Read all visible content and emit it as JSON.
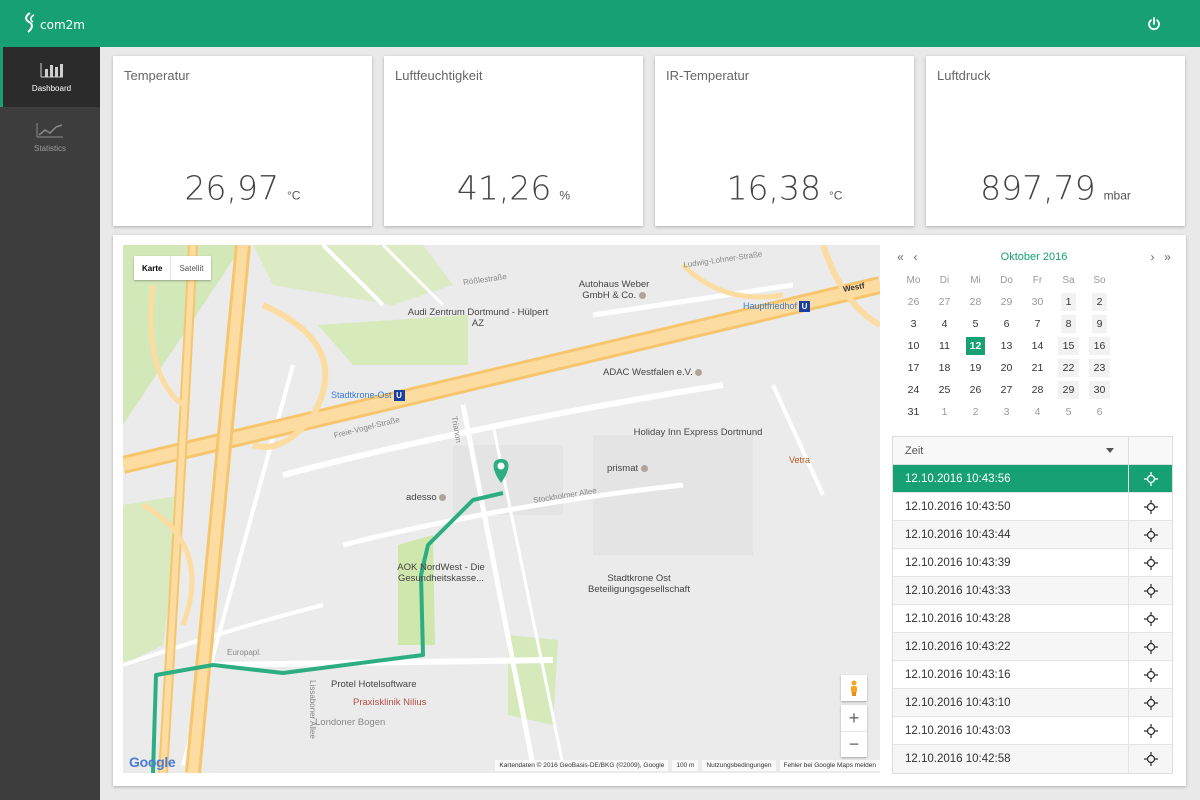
{
  "app": {
    "logo_text": "com2m"
  },
  "header": {
    "power_icon": "power-icon"
  },
  "sidebar": {
    "items": [
      {
        "label": "Dashboard",
        "icon": "bar-chart-icon",
        "active": true
      },
      {
        "label": "Statistics",
        "icon": "line-chart-icon",
        "active": false
      }
    ]
  },
  "cards": [
    {
      "title": "Temperatur",
      "value": "26,97",
      "unit": "°C"
    },
    {
      "title": "Luftfeuchtigkeit",
      "value": "41,26",
      "unit": "%"
    },
    {
      "title": "IR-Temperatur",
      "value": "16,38",
      "unit": "°C"
    },
    {
      "title": "Luftdruck",
      "value": "897,79",
      "unit": "mbar"
    }
  ],
  "map": {
    "type_map": "Karte",
    "type_satellite": "Satellit",
    "zoom_in": "+",
    "zoom_out": "−",
    "google_logo": "Google",
    "footer": {
      "data": "Kartendaten © 2016 GeoBasis-DE/BKG (©2009), Google",
      "scale": "100 m",
      "terms": "Nutzungsbedingungen",
      "report": "Fehler bei Google Maps melden"
    },
    "pois": [
      "Autohaus Weber GmbH & Co.",
      "Audi Zentrum Dortmund - Hülpert AZ",
      "ADAC Westfalen e.V.",
      "Holiday Inn Express Dortmund",
      "prismat",
      "Vetra",
      "adesso",
      "AOK NordWest - Die Gesundheitskasse...",
      "Stadtkrone Ost Beteiligungsgesellschaft",
      "Protel Hotelsoftware",
      "Praxisklinik Nilius",
      "Londoner Bogen"
    ],
    "stations": [
      "Hauptfriedhof",
      "Stadtkrone-Ost"
    ],
    "streets": [
      "Ludwig-Lohner-Straße",
      "Rößlestraße",
      "Freie-Vogel-Straße",
      "Stockholmer Allee",
      "Europapl.",
      "Lissaboner Allee",
      "Westf",
      "Trianon"
    ]
  },
  "calendar": {
    "prev_year": "«",
    "prev_month": "‹",
    "month_label": "Oktober 2016",
    "next_month": "›",
    "next_year": "»",
    "weekdays": [
      "Mo",
      "Di",
      "Mi",
      "Do",
      "Fr",
      "Sa",
      "So"
    ],
    "weeks": [
      [
        "26",
        "27",
        "28",
        "29",
        "30",
        "1",
        "2"
      ],
      [
        "3",
        "4",
        "5",
        "6",
        "7",
        "8",
        "9"
      ],
      [
        "10",
        "11",
        "12",
        "13",
        "14",
        "15",
        "16"
      ],
      [
        "17",
        "18",
        "19",
        "20",
        "21",
        "22",
        "23"
      ],
      [
        "24",
        "25",
        "26",
        "27",
        "28",
        "29",
        "30"
      ],
      [
        "31",
        "1",
        "2",
        "3",
        "4",
        "5",
        "6"
      ]
    ],
    "selected_day": "12"
  },
  "time_table": {
    "header": "Zeit",
    "rows": [
      "12.10.2016 10:43:56",
      "12.10.2016 10:43:50",
      "12.10.2016 10:43:44",
      "12.10.2016 10:43:39",
      "12.10.2016 10:43:33",
      "12.10.2016 10:43:28",
      "12.10.2016 10:43:22",
      "12.10.2016 10:43:16",
      "12.10.2016 10:43:10",
      "12.10.2016 10:43:03",
      "12.10.2016 10:42:58"
    ],
    "active_row": 0,
    "row_icon": "crosshair-icon"
  },
  "colors": {
    "brand": "#16a074",
    "sidebar": "#3d3d3d",
    "route": "#2dae82"
  }
}
